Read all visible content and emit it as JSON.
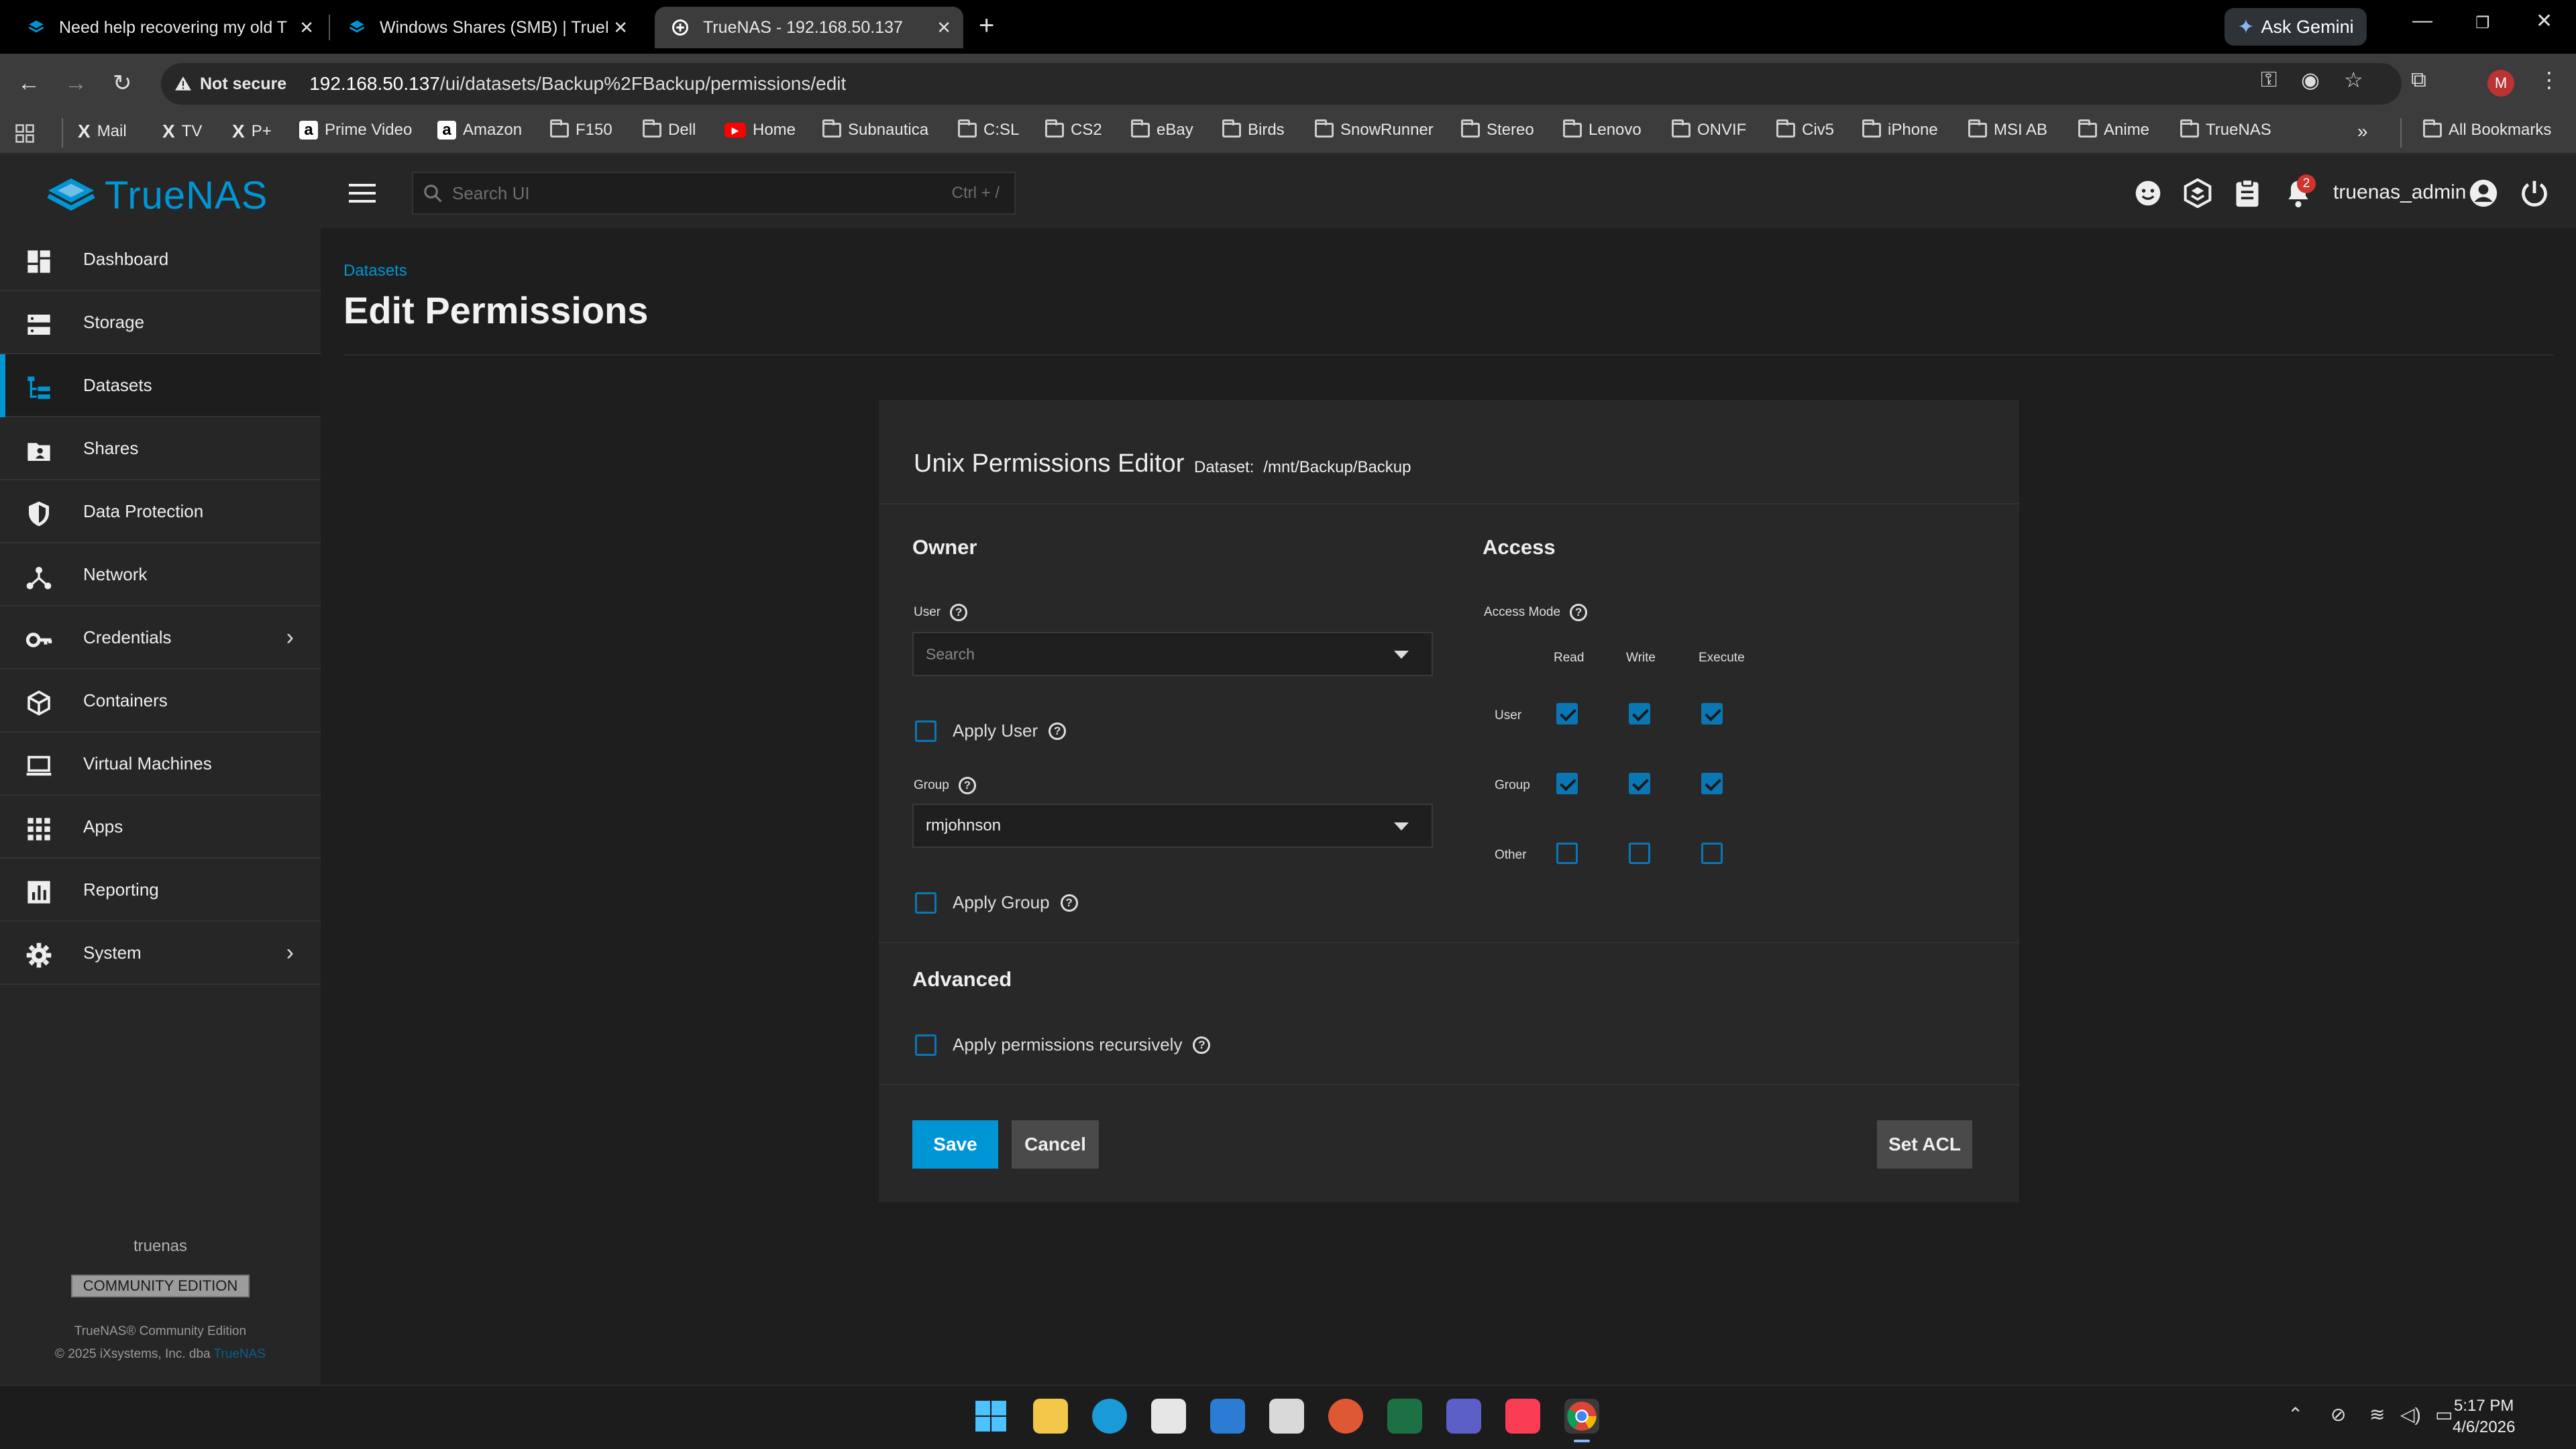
{
  "browser": {
    "tabs": [
      {
        "title": "Need help recovering my old Tr"
      },
      {
        "title": "Windows Shares (SMB) | TrueN"
      },
      {
        "title": "TrueNAS - 192.168.50.137"
      }
    ],
    "new_tab": "+",
    "gemini_label": "Ask Gemini",
    "security_label": "Not secure",
    "url_host": "192.168.50.137",
    "url_path": "/ui/datasets/Backup%2FBackup/permissions/edit",
    "profile_initial": "M",
    "bookmarks": [
      {
        "label": "Mail",
        "icon": "x-icon"
      },
      {
        "label": "TV",
        "icon": "x-icon"
      },
      {
        "label": "P+",
        "icon": "x-icon"
      },
      {
        "label": "Prime Video",
        "icon": "amazon-icon"
      },
      {
        "label": "Amazon",
        "icon": "amazon-icon"
      },
      {
        "label": "F150",
        "icon": "folder-icon"
      },
      {
        "label": "Dell",
        "icon": "folder-icon"
      },
      {
        "label": "Home",
        "icon": "youtube-icon"
      },
      {
        "label": "Subnautica",
        "icon": "folder-icon"
      },
      {
        "label": "C:SL",
        "icon": "folder-icon"
      },
      {
        "label": "CS2",
        "icon": "folder-icon"
      },
      {
        "label": "eBay",
        "icon": "folder-icon"
      },
      {
        "label": "Birds",
        "icon": "folder-icon"
      },
      {
        "label": "SnowRunner",
        "icon": "folder-icon"
      },
      {
        "label": "Stereo",
        "icon": "folder-icon"
      },
      {
        "label": "Lenovo",
        "icon": "folder-icon"
      },
      {
        "label": "ONVIF",
        "icon": "folder-icon"
      },
      {
        "label": "Civ5",
        "icon": "folder-icon"
      },
      {
        "label": "iPhone",
        "icon": "folder-icon"
      },
      {
        "label": "MSI AB",
        "icon": "folder-icon"
      },
      {
        "label": "Anime",
        "icon": "folder-icon"
      },
      {
        "label": "TrueNAS",
        "icon": "folder-icon"
      }
    ],
    "all_bookmarks": "All Bookmarks"
  },
  "app": {
    "brand": "TrueNAS",
    "search_placeholder": "Search UI",
    "search_shortcut": "Ctrl + /",
    "notification_count": "2",
    "username": "truenas_admin",
    "accent_color": "#0095d5"
  },
  "sidebar": {
    "items": [
      {
        "label": "Dashboard",
        "icon": "dashboard-icon"
      },
      {
        "label": "Storage",
        "icon": "storage-icon"
      },
      {
        "label": "Datasets",
        "icon": "datasets-icon",
        "active": true
      },
      {
        "label": "Shares",
        "icon": "shares-icon"
      },
      {
        "label": "Data Protection",
        "icon": "shield-icon"
      },
      {
        "label": "Network",
        "icon": "network-icon"
      },
      {
        "label": "Credentials",
        "icon": "key-icon",
        "expandable": true
      },
      {
        "label": "Containers",
        "icon": "cube-icon"
      },
      {
        "label": "Virtual Machines",
        "icon": "monitor-icon"
      },
      {
        "label": "Apps",
        "icon": "apps-grid-icon"
      },
      {
        "label": "Reporting",
        "icon": "reporting-icon"
      },
      {
        "label": "System",
        "icon": "gear-icon",
        "expandable": true
      }
    ],
    "hostname": "truenas",
    "edition": "COMMUNITY EDITION",
    "copyright_line1": "TrueNAS® Community Edition",
    "copyright_line2": "© 2025 iXsystems, Inc. dba",
    "copyright_link": "TrueNAS"
  },
  "page": {
    "breadcrumb": "Datasets",
    "title": "Edit Permissions"
  },
  "editor": {
    "title": "Unix Permissions Editor",
    "dataset_label": "Dataset:",
    "dataset_path": "/mnt/Backup/Backup",
    "owner": {
      "heading": "Owner",
      "user_label": "User",
      "user_placeholder": "Search",
      "apply_user_label": "Apply User",
      "apply_user_checked": false,
      "group_label": "Group",
      "group_value": "rmjohnson",
      "apply_group_label": "Apply Group",
      "apply_group_checked": false
    },
    "access": {
      "heading": "Access",
      "mode_label": "Access Mode",
      "columns": [
        "Read",
        "Write",
        "Execute"
      ],
      "rows": [
        {
          "label": "User",
          "values": [
            true,
            true,
            true
          ]
        },
        {
          "label": "Group",
          "values": [
            true,
            true,
            true
          ]
        },
        {
          "label": "Other",
          "values": [
            false,
            false,
            false
          ]
        }
      ]
    },
    "advanced": {
      "heading": "Advanced",
      "recursive_label": "Apply permissions recursively",
      "recursive_checked": false
    },
    "buttons": {
      "save": "Save",
      "cancel": "Cancel",
      "set_acl": "Set ACL"
    }
  },
  "taskbar": {
    "time": "5:17 PM",
    "date": "4/6/2026"
  }
}
